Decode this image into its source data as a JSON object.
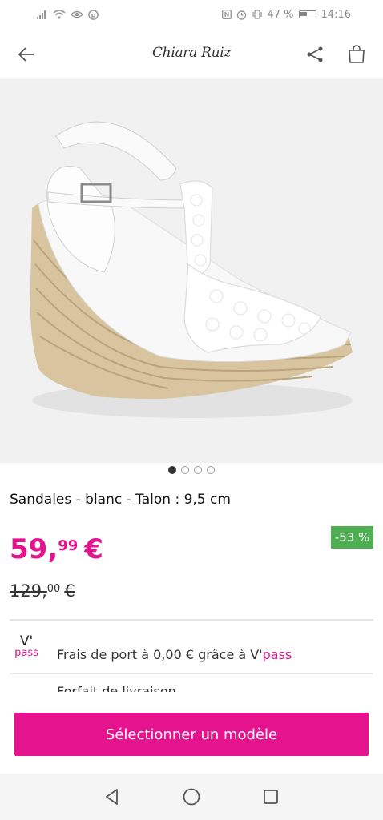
{
  "status_bar": {
    "battery_percent": "47 %",
    "time": "14:16",
    "left_icons": [
      "signal-icon",
      "wifi-icon",
      "eye-icon",
      "pinterest-icon"
    ],
    "right_icons": [
      "nfc-icon",
      "alarm-icon",
      "vibrate-icon",
      "battery-icon"
    ]
  },
  "header": {
    "brand_logo": "Chiara Ruiz",
    "icons": [
      "back-arrow-icon",
      "share-icon",
      "shopping-bag-icon"
    ]
  },
  "product": {
    "image": "white wedge espadrille sandal with lace t-strap",
    "carousel": {
      "count": 4,
      "active_index": 0
    },
    "title": "Sandales - blanc - Talon : 9,5 cm",
    "price": {
      "int": "59,",
      "cents": "99",
      "currency": "€"
    },
    "old_price": {
      "int": "129,",
      "cents": "00",
      "currency": "€"
    },
    "discount": "-53 %"
  },
  "shipping": {
    "logo_v": "V'",
    "logo_pass": "pass",
    "text": "Frais de port à 0,00 € grâce à V'",
    "highlight": "pass",
    "next_line": "Forfait de livraison"
  },
  "cta": {
    "label": "Sélectionner un modèle"
  },
  "colors": {
    "accent": "#e5138e",
    "discount": "#4caf50"
  }
}
